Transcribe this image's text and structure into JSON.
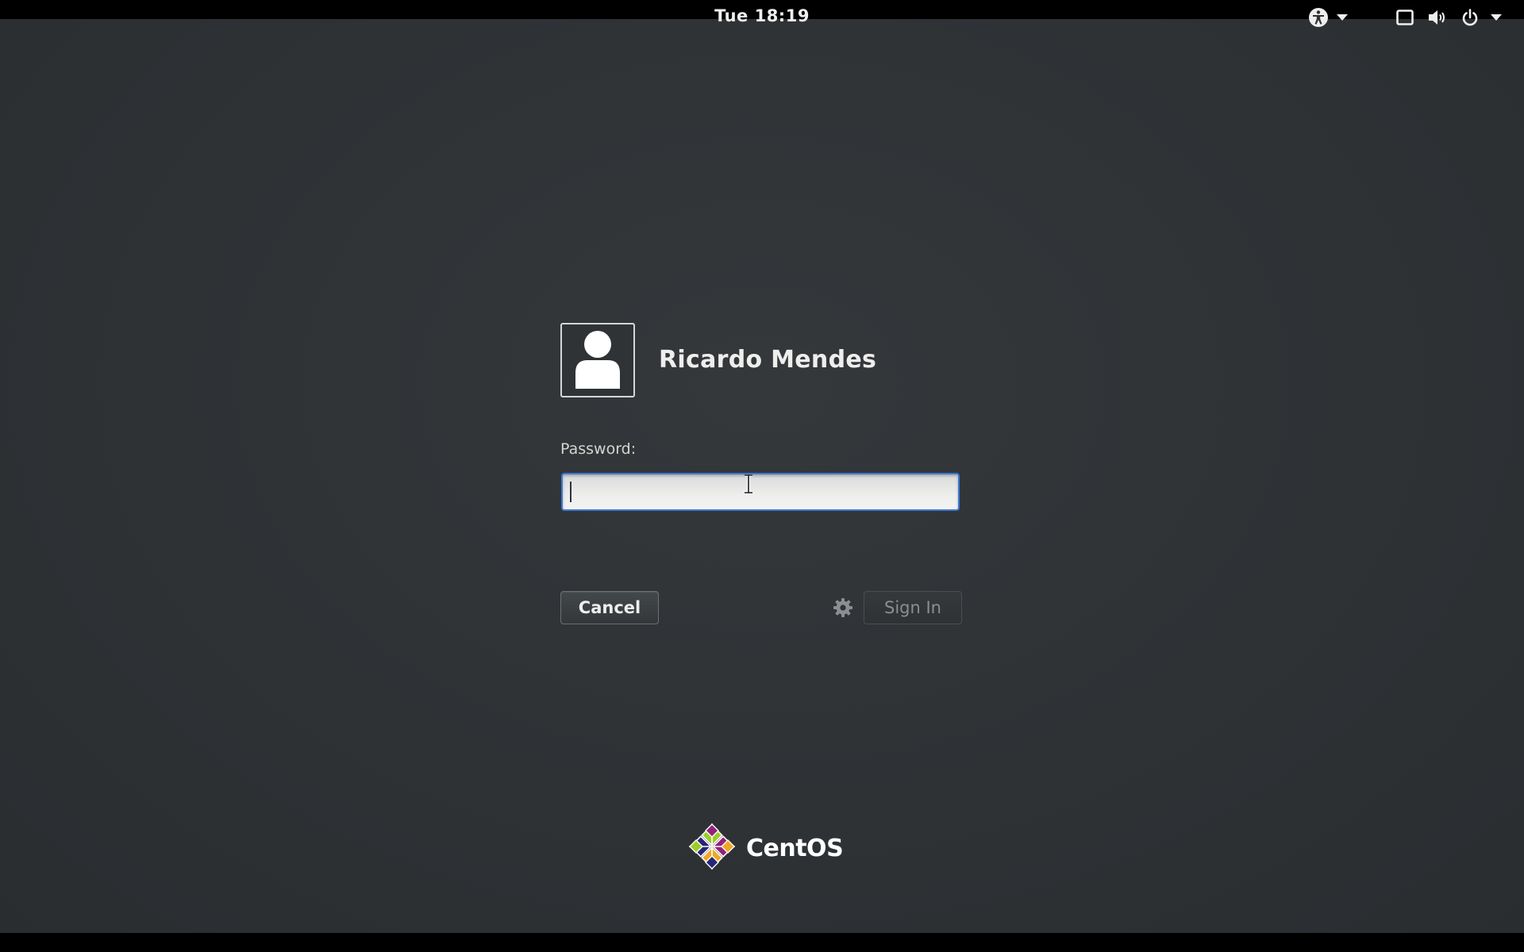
{
  "top_bar": {
    "clock": "Tue 18:19",
    "icons": [
      "accessibility-icon",
      "chevron-down-icon",
      "display-icon",
      "volume-icon",
      "power-icon",
      "chevron-down-icon"
    ]
  },
  "login": {
    "user_name": "Ricardo Mendes",
    "avatar_icon": "user-avatar-icon",
    "password_label": "Password:",
    "password_value": "",
    "cancel_label": "Cancel",
    "sign_in_label": "Sign In",
    "settings_icon": "gear-icon"
  },
  "branding": {
    "logo_text": "CentOS"
  },
  "colors": {
    "background": "#2e3235",
    "focus_border": "#3b78d8",
    "text": "#eeeeec"
  }
}
